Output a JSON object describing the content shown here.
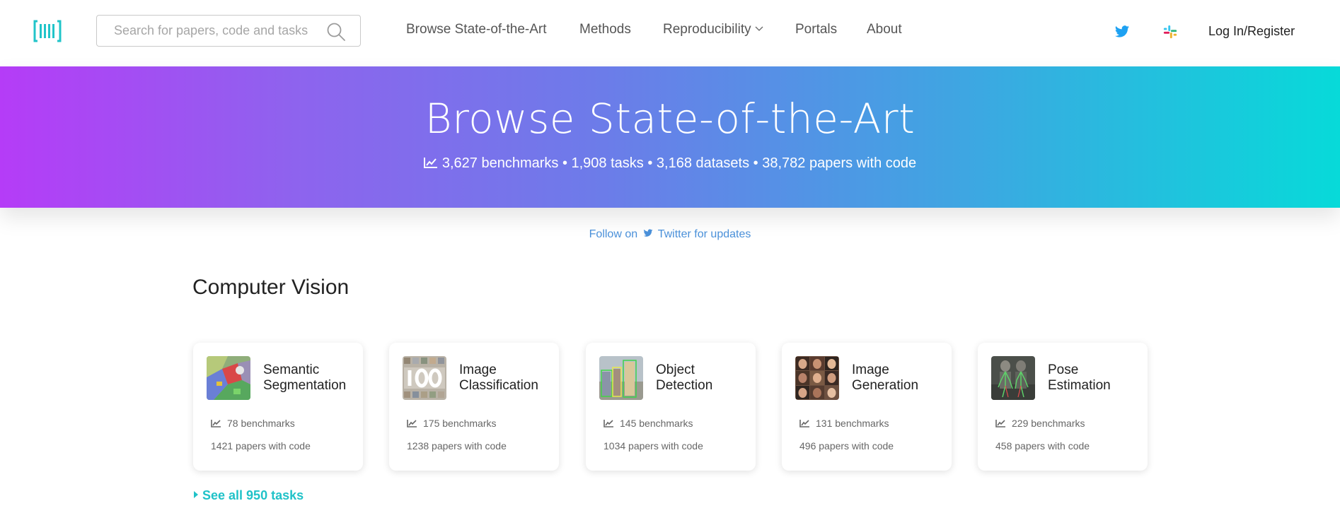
{
  "header": {
    "search_placeholder": "Search for papers, code and tasks",
    "nav": {
      "browse": "Browse State-of-the-Art",
      "methods": "Methods",
      "reproducibility": "Reproducibility",
      "portals": "Portals",
      "about": "About"
    },
    "login": "Log In/Register",
    "icons": [
      "logo-icon",
      "search-icon",
      "chevron-down-icon",
      "twitter-icon",
      "slack-icon"
    ],
    "colors": {
      "logo": "#21c4c9",
      "twitter": "#1da1f2"
    }
  },
  "hero": {
    "title": "Browse State-of-the-Art",
    "stats": "3,627 benchmarks • 1,908 tasks • 3,168 datasets • 38,782 papers with code",
    "gradient": [
      "#b53cf7",
      "#6c7ce9",
      "#07dad9"
    ]
  },
  "follow": {
    "prefix": "Follow on",
    "suffix": "Twitter for updates"
  },
  "section": {
    "title": "Computer Vision",
    "see_all": "See all 950 tasks",
    "tasks": [
      {
        "title": "Semantic Segmentation",
        "benchmarks": "78 benchmarks",
        "papers": "1421 papers with code"
      },
      {
        "title": "Image Classification",
        "benchmarks": "175 benchmarks",
        "papers": "1238 papers with code"
      },
      {
        "title": "Object Detection",
        "benchmarks": "145 benchmarks",
        "papers": "1034 papers with code"
      },
      {
        "title": "Image Generation",
        "benchmarks": "131 benchmarks",
        "papers": "496 papers with code"
      },
      {
        "title": "Pose Estimation",
        "benchmarks": "229 benchmarks",
        "papers": "458 papers with code"
      }
    ]
  },
  "accent_color": "#20c2c8",
  "link_color": "#4a90d9"
}
